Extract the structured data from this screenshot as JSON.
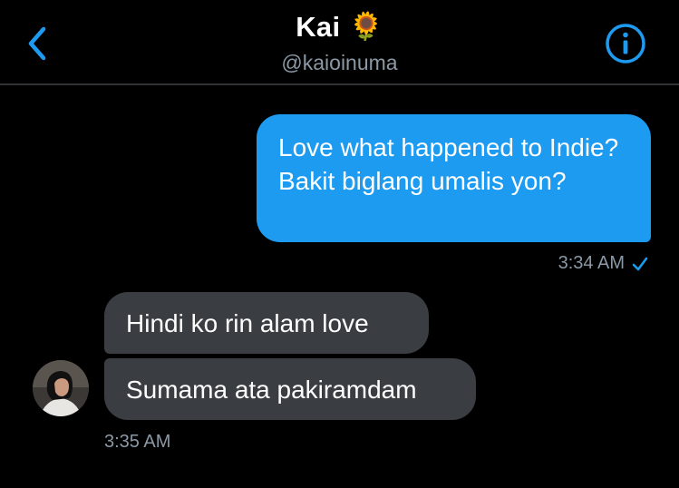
{
  "header": {
    "title": "Kai",
    "title_emoji": "🌻",
    "handle": "@kaioinuma",
    "back_icon": "chevron-left-icon",
    "info_icon": "info-icon"
  },
  "messages": {
    "outgoing": {
      "text": "Love what happened to Indie? Bakit biglang umalis yon?",
      "time": "3:34 AM",
      "status_icon": "checkmark-icon"
    },
    "incoming": [
      {
        "text": "Hindi ko rin alam love"
      },
      {
        "text": "Sumama ata pakiramdam"
      }
    ],
    "incoming_time": "3:35 AM"
  },
  "colors": {
    "background": "#000000",
    "accent": "#1d9bf0",
    "incoming_bubble": "#3a3d41",
    "muted_text": "#8b98a5",
    "divider": "#2f3336"
  }
}
